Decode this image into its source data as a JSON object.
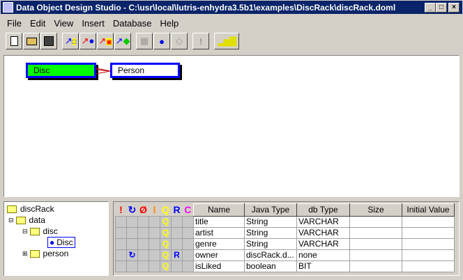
{
  "window": {
    "title": "Data Object Design Studio - C:\\usr\\local\\lutris-enhydra3.5b1\\examples\\DiscRack\\discRack.doml",
    "min": "_",
    "max": "□",
    "close": "×"
  },
  "menu": [
    "File",
    "Edit",
    "View",
    "Insert",
    "Database",
    "Help"
  ],
  "toolbar": [
    "new-icon",
    "open-icon",
    "save-icon",
    "add-table-icon",
    "add-column-icon",
    "add-index-icon",
    "add-reference-icon",
    "table-icon",
    "circle-icon",
    "diamond-icon",
    "exclamation-icon",
    "chart-icon"
  ],
  "diagram": {
    "nodes": [
      "Disc",
      "Person"
    ],
    "colors": {
      "disc": "#00ff00",
      "border": "#0000ff"
    }
  },
  "tree": {
    "root": "discRack",
    "data": "data",
    "disc": "disc",
    "disc_item": "Disc",
    "person": "person"
  },
  "grid": {
    "icon_headers": [
      "!",
      "↻",
      "Ø",
      "I",
      "Q",
      "R",
      "C"
    ],
    "headers": [
      "Name",
      "Java Type",
      "db Type",
      "Size",
      "Initial Value"
    ],
    "rows": [
      {
        "flags": [
          "",
          "",
          "",
          "",
          "Q",
          "",
          ""
        ],
        "cells": [
          "title",
          "String",
          "VARCHAR",
          "",
          ""
        ]
      },
      {
        "flags": [
          "",
          "",
          "",
          "",
          "Q",
          "",
          ""
        ],
        "cells": [
          "artist",
          "String",
          "VARCHAR",
          "",
          ""
        ]
      },
      {
        "flags": [
          "",
          "",
          "",
          "",
          "Q",
          "",
          ""
        ],
        "cells": [
          "genre",
          "String",
          "VARCHAR",
          "",
          ""
        ]
      },
      {
        "flags": [
          "",
          "↻",
          "",
          "",
          "Q",
          "R",
          ""
        ],
        "cells": [
          "owner",
          "discRack.d...",
          "none",
          "",
          ""
        ]
      },
      {
        "flags": [
          "",
          "",
          "",
          "",
          "Q",
          "",
          ""
        ],
        "cells": [
          "isLiked",
          "boolean",
          "BIT",
          "",
          ""
        ]
      }
    ]
  }
}
